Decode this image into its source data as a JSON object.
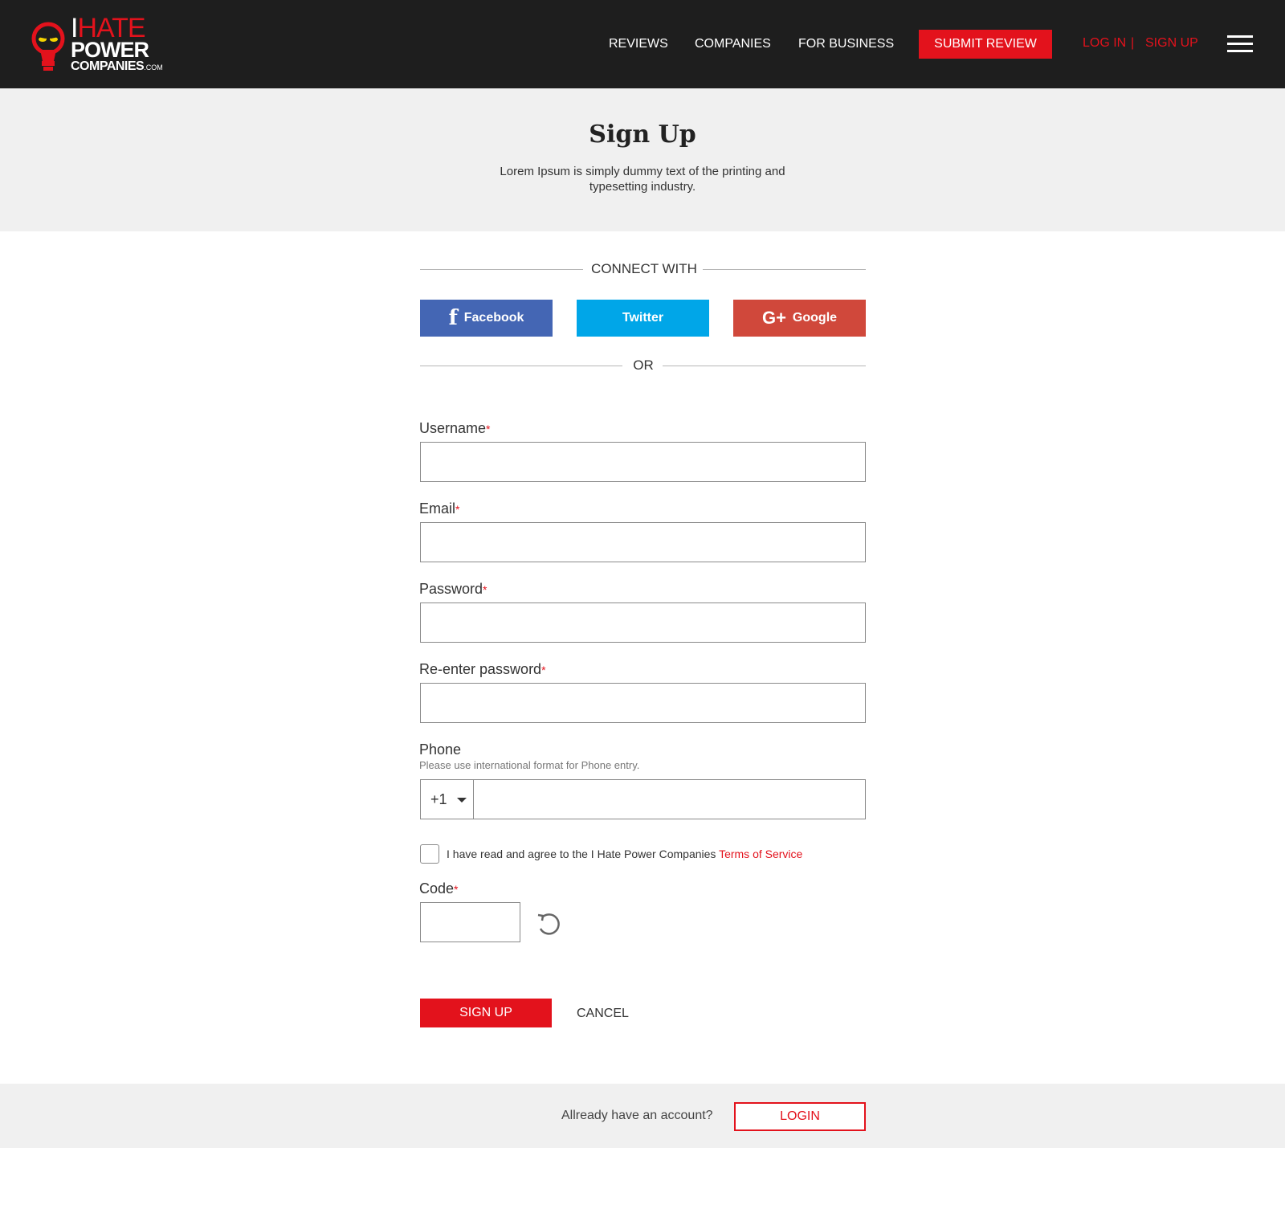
{
  "header": {
    "logo": {
      "line1_i": "I",
      "line1_hate": "HATE",
      "line2": "POWER",
      "line3": "COMPANIES",
      "line3_suffix": ".COM"
    },
    "nav": [
      "REVIEWS",
      "COMPANIES",
      "FOR BUSINESS"
    ],
    "submit_review": "SUBMIT REVIEW",
    "login": "LOG IN",
    "separator": "|",
    "signup": "SIGN UP"
  },
  "hero": {
    "title": "Sign Up",
    "subtitle": "Lorem Ipsum is simply dummy text of the printing and typesetting industry."
  },
  "form": {
    "connect_with": "CONNECT WITH",
    "or": "OR",
    "social": {
      "facebook": "Facebook",
      "twitter": "Twitter",
      "google": "Google"
    },
    "fields": {
      "username": {
        "label": "Username",
        "required": "*",
        "value": ""
      },
      "email": {
        "label": "Email",
        "required": "*",
        "value": ""
      },
      "password": {
        "label": "Password",
        "required": "*",
        "value": ""
      },
      "reenter": {
        "label": "Re-enter password",
        "required": "*",
        "value": ""
      },
      "phone": {
        "label": "Phone",
        "hint": "Please use international format for Phone entry.",
        "code": "+1",
        "value": ""
      },
      "code": {
        "label": "Code",
        "required": "*",
        "value": ""
      }
    },
    "terms": {
      "text": "I have read and agree to the I Hate Power Companies ",
      "link": "Terms of Service",
      "checked": false
    },
    "signup_button": "SIGN UP",
    "cancel_button": "CANCEL"
  },
  "footer": {
    "question": "Allready have an account?",
    "login_button": "LOGIN"
  },
  "colors": {
    "header_bg": "#1e1e1e",
    "accent": "#e3121c",
    "facebook": "#4466b4",
    "twitter": "#00a6e8",
    "google": "#d0483b",
    "panel_bg": "#f0f0f0"
  },
  "icons": [
    "lightbulb-logo-icon",
    "hamburger-menu-icon",
    "facebook-icon",
    "google-plus-icon",
    "chevron-down-icon",
    "refresh-icon"
  ]
}
